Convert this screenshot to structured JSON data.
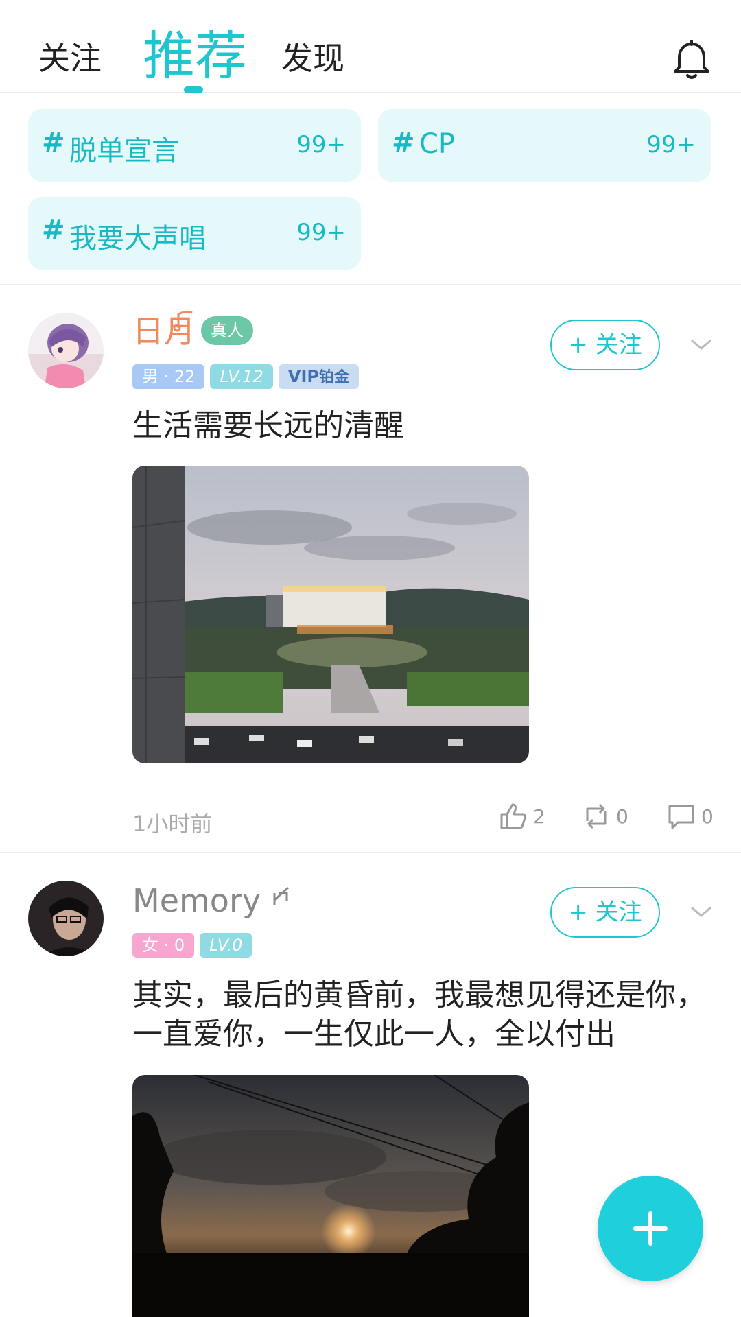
{
  "header": {
    "tabs": {
      "follow": "关注",
      "recommend": "推荐",
      "discover": "发现"
    },
    "bell_icon": "bell-icon"
  },
  "topics": [
    {
      "name": "脱单宣言",
      "count": "99+"
    },
    {
      "name": "CP",
      "count": "99+"
    },
    {
      "name": "我要大声唱",
      "count": "99+"
    }
  ],
  "posts": [
    {
      "username": "日月",
      "username_color": "#f08a5d",
      "real_badge": "真人",
      "gender_age": "男 · 22",
      "level": "LV.12",
      "vip": "VIP",
      "vip_tier": "铂金",
      "follow_label": "+ 关注",
      "text": "生活需要长远的清醒",
      "time": "1小时前",
      "likes": "2",
      "reposts": "0",
      "comments": "0"
    },
    {
      "username": "Memory",
      "username_color": "#888888",
      "gender_age": "女 · 0",
      "level": "LV.0",
      "follow_label": "+ 关注",
      "text": "其实，最后的黄昏前，我最想见得还是你，一直爱你，一生仅此一人，全以付出"
    }
  ],
  "colors": {
    "accent": "#1fc6cf",
    "topic_bg": "#e5f9fa"
  }
}
